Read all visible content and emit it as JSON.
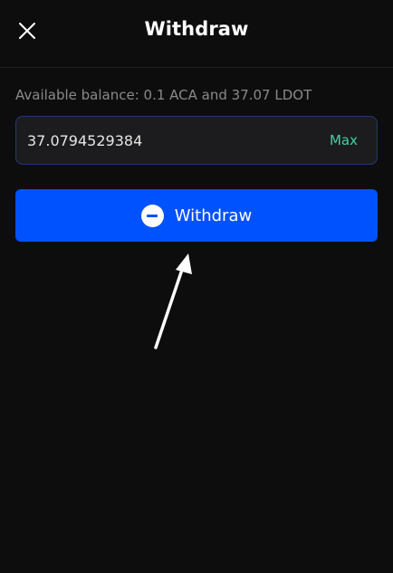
{
  "header": {
    "title": "Withdraw"
  },
  "balance": {
    "text": "Available balance: 0.1 ACA and 37.07 LDOT"
  },
  "amount": {
    "value": "37.0794529384",
    "max_label": "Max"
  },
  "withdraw_button": {
    "label": "Withdraw"
  },
  "colors": {
    "background": "#0d0d0d",
    "primary": "#0052ff",
    "max_accent": "#3fd4a0",
    "input_border": "#1f3a7a"
  },
  "icons": {
    "close": "close-icon",
    "withdraw": "minus-circle-icon",
    "annotation": "arrow-pointer-icon"
  }
}
